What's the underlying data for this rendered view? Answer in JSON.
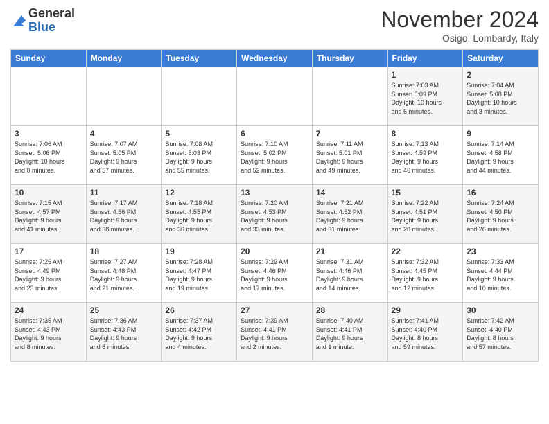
{
  "header": {
    "logo_line1": "General",
    "logo_line2": "Blue",
    "month_title": "November 2024",
    "subtitle": "Osigo, Lombardy, Italy"
  },
  "days_of_week": [
    "Sunday",
    "Monday",
    "Tuesday",
    "Wednesday",
    "Thursday",
    "Friday",
    "Saturday"
  ],
  "weeks": [
    [
      {
        "num": "",
        "info": ""
      },
      {
        "num": "",
        "info": ""
      },
      {
        "num": "",
        "info": ""
      },
      {
        "num": "",
        "info": ""
      },
      {
        "num": "",
        "info": ""
      },
      {
        "num": "1",
        "info": "Sunrise: 7:03 AM\nSunset: 5:09 PM\nDaylight: 10 hours\nand 6 minutes."
      },
      {
        "num": "2",
        "info": "Sunrise: 7:04 AM\nSunset: 5:08 PM\nDaylight: 10 hours\nand 3 minutes."
      }
    ],
    [
      {
        "num": "3",
        "info": "Sunrise: 7:06 AM\nSunset: 5:06 PM\nDaylight: 10 hours\nand 0 minutes."
      },
      {
        "num": "4",
        "info": "Sunrise: 7:07 AM\nSunset: 5:05 PM\nDaylight: 9 hours\nand 57 minutes."
      },
      {
        "num": "5",
        "info": "Sunrise: 7:08 AM\nSunset: 5:03 PM\nDaylight: 9 hours\nand 55 minutes."
      },
      {
        "num": "6",
        "info": "Sunrise: 7:10 AM\nSunset: 5:02 PM\nDaylight: 9 hours\nand 52 minutes."
      },
      {
        "num": "7",
        "info": "Sunrise: 7:11 AM\nSunset: 5:01 PM\nDaylight: 9 hours\nand 49 minutes."
      },
      {
        "num": "8",
        "info": "Sunrise: 7:13 AM\nSunset: 4:59 PM\nDaylight: 9 hours\nand 46 minutes."
      },
      {
        "num": "9",
        "info": "Sunrise: 7:14 AM\nSunset: 4:58 PM\nDaylight: 9 hours\nand 44 minutes."
      }
    ],
    [
      {
        "num": "10",
        "info": "Sunrise: 7:15 AM\nSunset: 4:57 PM\nDaylight: 9 hours\nand 41 minutes."
      },
      {
        "num": "11",
        "info": "Sunrise: 7:17 AM\nSunset: 4:56 PM\nDaylight: 9 hours\nand 38 minutes."
      },
      {
        "num": "12",
        "info": "Sunrise: 7:18 AM\nSunset: 4:55 PM\nDaylight: 9 hours\nand 36 minutes."
      },
      {
        "num": "13",
        "info": "Sunrise: 7:20 AM\nSunset: 4:53 PM\nDaylight: 9 hours\nand 33 minutes."
      },
      {
        "num": "14",
        "info": "Sunrise: 7:21 AM\nSunset: 4:52 PM\nDaylight: 9 hours\nand 31 minutes."
      },
      {
        "num": "15",
        "info": "Sunrise: 7:22 AM\nSunset: 4:51 PM\nDaylight: 9 hours\nand 28 minutes."
      },
      {
        "num": "16",
        "info": "Sunrise: 7:24 AM\nSunset: 4:50 PM\nDaylight: 9 hours\nand 26 minutes."
      }
    ],
    [
      {
        "num": "17",
        "info": "Sunrise: 7:25 AM\nSunset: 4:49 PM\nDaylight: 9 hours\nand 23 minutes."
      },
      {
        "num": "18",
        "info": "Sunrise: 7:27 AM\nSunset: 4:48 PM\nDaylight: 9 hours\nand 21 minutes."
      },
      {
        "num": "19",
        "info": "Sunrise: 7:28 AM\nSunset: 4:47 PM\nDaylight: 9 hours\nand 19 minutes."
      },
      {
        "num": "20",
        "info": "Sunrise: 7:29 AM\nSunset: 4:46 PM\nDaylight: 9 hours\nand 17 minutes."
      },
      {
        "num": "21",
        "info": "Sunrise: 7:31 AM\nSunset: 4:46 PM\nDaylight: 9 hours\nand 14 minutes."
      },
      {
        "num": "22",
        "info": "Sunrise: 7:32 AM\nSunset: 4:45 PM\nDaylight: 9 hours\nand 12 minutes."
      },
      {
        "num": "23",
        "info": "Sunrise: 7:33 AM\nSunset: 4:44 PM\nDaylight: 9 hours\nand 10 minutes."
      }
    ],
    [
      {
        "num": "24",
        "info": "Sunrise: 7:35 AM\nSunset: 4:43 PM\nDaylight: 9 hours\nand 8 minutes."
      },
      {
        "num": "25",
        "info": "Sunrise: 7:36 AM\nSunset: 4:43 PM\nDaylight: 9 hours\nand 6 minutes."
      },
      {
        "num": "26",
        "info": "Sunrise: 7:37 AM\nSunset: 4:42 PM\nDaylight: 9 hours\nand 4 minutes."
      },
      {
        "num": "27",
        "info": "Sunrise: 7:39 AM\nSunset: 4:41 PM\nDaylight: 9 hours\nand 2 minutes."
      },
      {
        "num": "28",
        "info": "Sunrise: 7:40 AM\nSunset: 4:41 PM\nDaylight: 9 hours\nand 1 minute."
      },
      {
        "num": "29",
        "info": "Sunrise: 7:41 AM\nSunset: 4:40 PM\nDaylight: 8 hours\nand 59 minutes."
      },
      {
        "num": "30",
        "info": "Sunrise: 7:42 AM\nSunset: 4:40 PM\nDaylight: 8 hours\nand 57 minutes."
      }
    ]
  ]
}
